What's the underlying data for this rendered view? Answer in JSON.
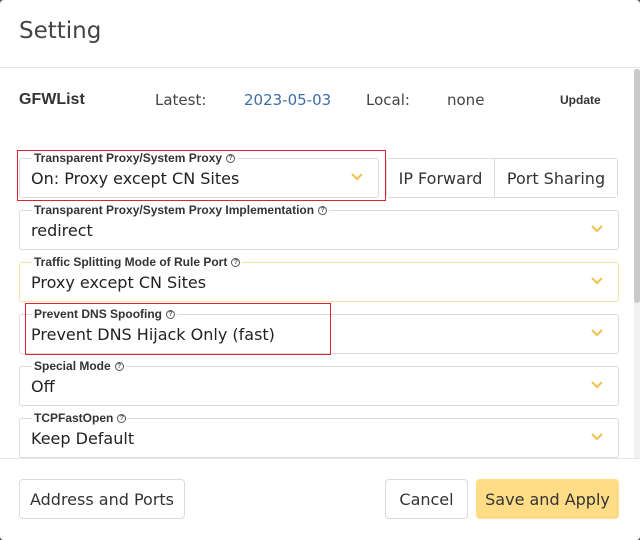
{
  "dialog": {
    "title": "Setting"
  },
  "gfwlist": {
    "title": "GFWList",
    "latest_label": "Latest:",
    "latest_value": "2023-05-03",
    "local_label": "Local:",
    "local_value": "none",
    "update_label": "Update"
  },
  "fields": {
    "proxy_mode": {
      "label": "Transparent Proxy/System Proxy",
      "value": "On: Proxy except CN Sites"
    },
    "proxy_impl": {
      "label": "Transparent Proxy/System Proxy Implementation",
      "value": "redirect"
    },
    "split_mode": {
      "label": "Traffic Splitting Mode of Rule Port",
      "value": "Proxy except CN Sites"
    },
    "dns_spoof": {
      "label": "Prevent DNS Spoofing",
      "value": "Prevent DNS Hijack Only (fast)"
    },
    "special_mode": {
      "label": "Special Mode",
      "value": "Off"
    },
    "tcp_fast_open": {
      "label": "TCPFastOpen",
      "value": "Keep Default"
    }
  },
  "segment_buttons": {
    "ip_forward": "IP Forward",
    "port_sharing": "Port Sharing"
  },
  "footer": {
    "address_ports": "Address and Ports",
    "cancel": "Cancel",
    "save_apply": "Save and Apply"
  },
  "icons": {
    "help": "help-circle-icon",
    "dropdown": "chevron-down-icon"
  },
  "colors": {
    "accent": "#ffdd86",
    "chevron": "#f0c24b",
    "link": "#3b6ea5",
    "highlight_box": "#d9262c"
  }
}
